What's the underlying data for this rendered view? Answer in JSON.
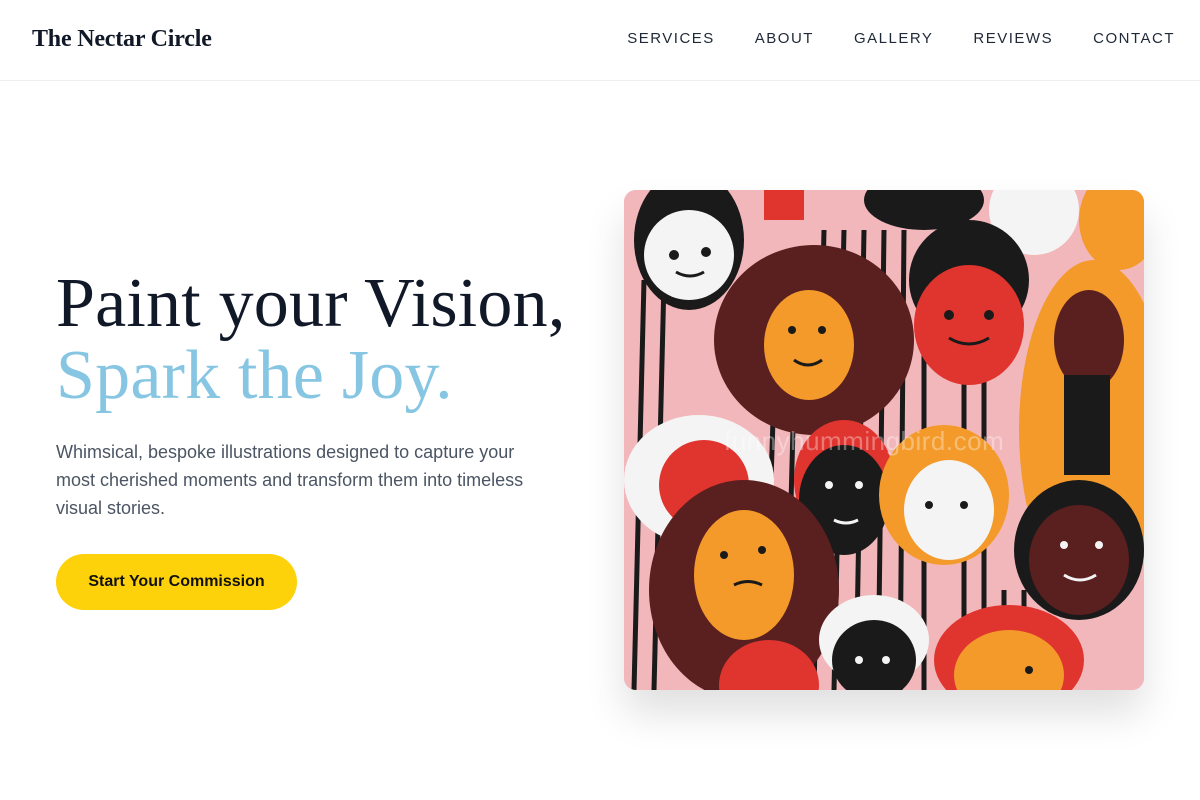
{
  "header": {
    "brand": "The Nectar Circle",
    "nav": [
      "SERVICES",
      "ABOUT",
      "GALLERY",
      "REVIEWS",
      "CONTACT"
    ]
  },
  "hero": {
    "title_line1": "Paint your Vision,",
    "title_line2": "Spark the Joy.",
    "description": "Whimsical, bespoke illustrations designed to capture your most cherished moments and transform them into timeless visual stories.",
    "cta_label": "Start Your Commission",
    "image": {
      "watermark": "funnyhummingbird.com"
    }
  },
  "colors": {
    "accent": "#87c6e2",
    "cta": "#fdd20a",
    "text": "#111827",
    "muted": "#4b5563"
  }
}
